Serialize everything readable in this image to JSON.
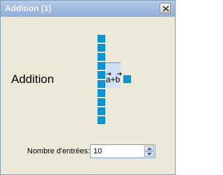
{
  "window": {
    "title": "Addition (1)",
    "close_icon": "close-icon"
  },
  "block": {
    "title": "Addition",
    "operator_symbol": "a+b",
    "operator_icon": "vector-sum-icon",
    "input_port_count": 10,
    "output_port_count": 1,
    "port_color": "#0a97d9"
  },
  "inputs_field": {
    "label": "Nombre d'entrées:",
    "value": "10",
    "increment_icon": "spin-up-icon",
    "decrement_icon": "spin-down-icon"
  },
  "colors": {
    "titlebar": "#a3bde0",
    "window_bg": "#ece9d8",
    "port": "#0a97d9"
  }
}
